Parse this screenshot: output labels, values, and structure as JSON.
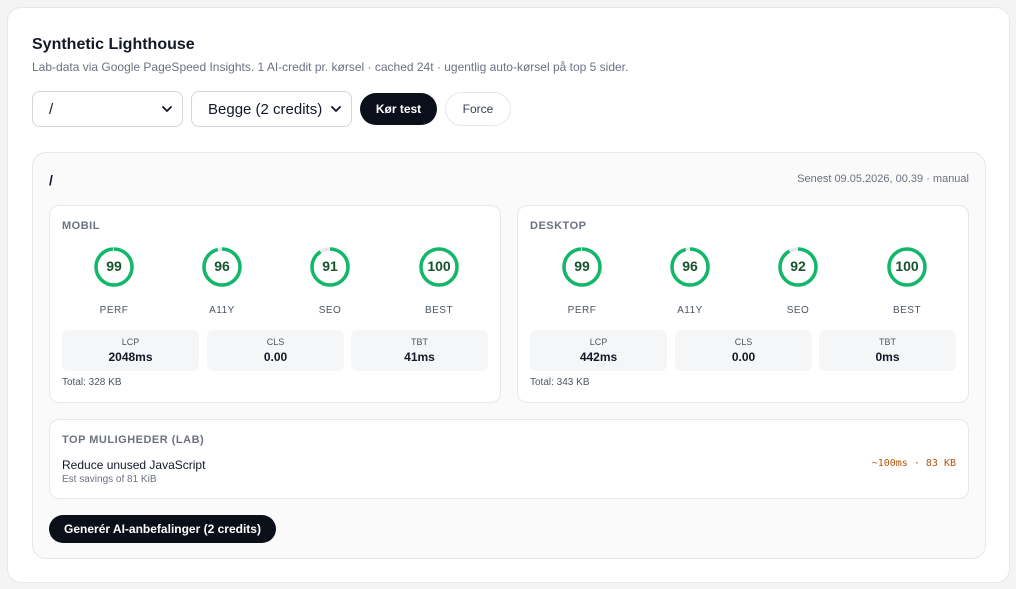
{
  "header": {
    "title": "Synthetic Lighthouse",
    "subtitle": "Lab-data via Google PageSpeed Insights. 1 AI-credit pr. kørsel · cached 24t · ugentlig auto-kørsel på top 5 sider."
  },
  "controls": {
    "page_select": "/",
    "mode_select": "Begge (2 credits)",
    "run_label": "Kør test",
    "force_label": "Force"
  },
  "result": {
    "path": "/",
    "last_run": "Senest 09.05.2026, 00.39 · manual",
    "mobile": {
      "heading": "MOBIL",
      "scores": [
        {
          "label": "PERF",
          "value": 99
        },
        {
          "label": "A11Y",
          "value": 96
        },
        {
          "label": "SEO",
          "value": 91
        },
        {
          "label": "BEST",
          "value": 100
        }
      ],
      "metrics": [
        {
          "label": "LCP",
          "value": "2048ms"
        },
        {
          "label": "CLS",
          "value": "0.00"
        },
        {
          "label": "TBT",
          "value": "41ms"
        }
      ],
      "total": "Total: 328 KB"
    },
    "desktop": {
      "heading": "DESKTOP",
      "scores": [
        {
          "label": "PERF",
          "value": 99
        },
        {
          "label": "A11Y",
          "value": 96
        },
        {
          "label": "SEO",
          "value": 92
        },
        {
          "label": "BEST",
          "value": 100
        }
      ],
      "metrics": [
        {
          "label": "LCP",
          "value": "442ms"
        },
        {
          "label": "CLS",
          "value": "0.00"
        },
        {
          "label": "TBT",
          "value": "0ms"
        }
      ],
      "total": "Total: 343 KB"
    },
    "opportunities": {
      "heading": "TOP MULIGHEDER (LAB)",
      "items": [
        {
          "title": "Reduce unused JavaScript",
          "detail": "Est savings of 81 KiB",
          "impact": "~100ms · 83 KB"
        }
      ]
    },
    "ai_button_label": "Generér AI-anbefalinger (2 credits)"
  },
  "colors": {
    "gauge_good": "#12b76a",
    "gauge_track": "#e5e7eb",
    "primary": "#0b0f19",
    "impact": "#b45309"
  },
  "icons": {
    "select_chevron": "chevron-down-icon"
  }
}
